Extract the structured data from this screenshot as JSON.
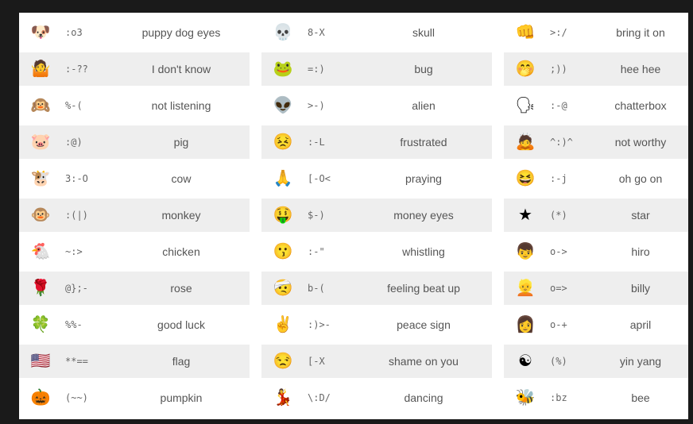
{
  "columns": [
    [
      {
        "icon": "dog-face-icon",
        "glyph": "🐶",
        "code": ":o3",
        "name": "puppy dog eyes"
      },
      {
        "icon": "shrug-face-icon",
        "glyph": "🤷",
        "code": ":-??",
        "name": "I don't know"
      },
      {
        "icon": "covered-ears-face-icon",
        "glyph": "🙉",
        "code": "%-(",
        "name": "not listening"
      },
      {
        "icon": "pig-face-icon",
        "glyph": "🐷",
        "code": ":@)",
        "name": "pig"
      },
      {
        "icon": "cow-face-icon",
        "glyph": "🐮",
        "code": "3:-O",
        "name": "cow"
      },
      {
        "icon": "monkey-face-icon",
        "glyph": "🐵",
        "code": ":(|)",
        "name": "monkey"
      },
      {
        "icon": "chicken-icon",
        "glyph": "🐔",
        "code": "~:>",
        "name": "chicken"
      },
      {
        "icon": "rose-icon",
        "glyph": "🌹",
        "code": "@};-",
        "name": "rose"
      },
      {
        "icon": "clover-icon",
        "glyph": "🍀",
        "code": "%%-",
        "name": "good luck"
      },
      {
        "icon": "us-flag-icon",
        "glyph": "🇺🇸",
        "code": "**==",
        "name": "flag"
      },
      {
        "icon": "pumpkin-icon",
        "glyph": "🎃",
        "code": "(~~)",
        "name": "pumpkin"
      }
    ],
    [
      {
        "icon": "skull-icon",
        "glyph": "💀",
        "code": "8-X",
        "name": "skull"
      },
      {
        "icon": "bug-icon",
        "glyph": "🐸",
        "code": "=:)",
        "name": "bug"
      },
      {
        "icon": "alien-icon",
        "glyph": "👽",
        "code": ">-)",
        "name": "alien"
      },
      {
        "icon": "frustrated-face-icon",
        "glyph": "😣",
        "code": ":-L",
        "name": "frustrated"
      },
      {
        "icon": "praying-face-icon",
        "glyph": "🙏",
        "code": "[-O<",
        "name": "praying"
      },
      {
        "icon": "money-eyes-face-icon",
        "glyph": "🤑",
        "code": "$-)",
        "name": "money eyes"
      },
      {
        "icon": "whistling-face-icon",
        "glyph": "😗",
        "code": ":-\"",
        "name": "whistling"
      },
      {
        "icon": "beat-up-face-icon",
        "glyph": "🤕",
        "code": "b-(",
        "name": "feeling beat up"
      },
      {
        "icon": "peace-sign-face-icon",
        "glyph": "✌",
        "code": ":)>-",
        "name": "peace sign"
      },
      {
        "icon": "shame-face-icon",
        "glyph": "😒",
        "code": "[-X",
        "name": "shame on you"
      },
      {
        "icon": "dancing-face-icon",
        "glyph": "💃",
        "code": "\\:D/",
        "name": "dancing"
      }
    ],
    [
      {
        "icon": "bring-it-on-face-icon",
        "glyph": "👊",
        "code": ">:/",
        "name": "bring it on"
      },
      {
        "icon": "hee-hee-face-icon",
        "glyph": "🤭",
        "code": ";))",
        "name": "hee hee"
      },
      {
        "icon": "chatterbox-face-icon",
        "glyph": "🗣",
        "code": ":-@",
        "name": "chatterbox"
      },
      {
        "icon": "not-worthy-face-icon",
        "glyph": "🙇",
        "code": "^:)^",
        "name": "not worthy"
      },
      {
        "icon": "oh-go-on-face-icon",
        "glyph": "😆",
        "code": ":-j",
        "name": "oh go on"
      },
      {
        "icon": "star-icon",
        "glyph": "★",
        "code": "(*)",
        "name": "star"
      },
      {
        "icon": "hiro-face-icon",
        "glyph": "👦",
        "code": "o->",
        "name": "hiro"
      },
      {
        "icon": "billy-face-icon",
        "glyph": "👱",
        "code": "o=>",
        "name": "billy"
      },
      {
        "icon": "april-face-icon",
        "glyph": "👩",
        "code": "o-+",
        "name": "april"
      },
      {
        "icon": "yin-yang-icon",
        "glyph": "☯",
        "code": "(%)",
        "name": "yin yang"
      },
      {
        "icon": "bee-icon",
        "glyph": "🐝",
        "code": ":bz",
        "name": "bee"
      }
    ]
  ]
}
